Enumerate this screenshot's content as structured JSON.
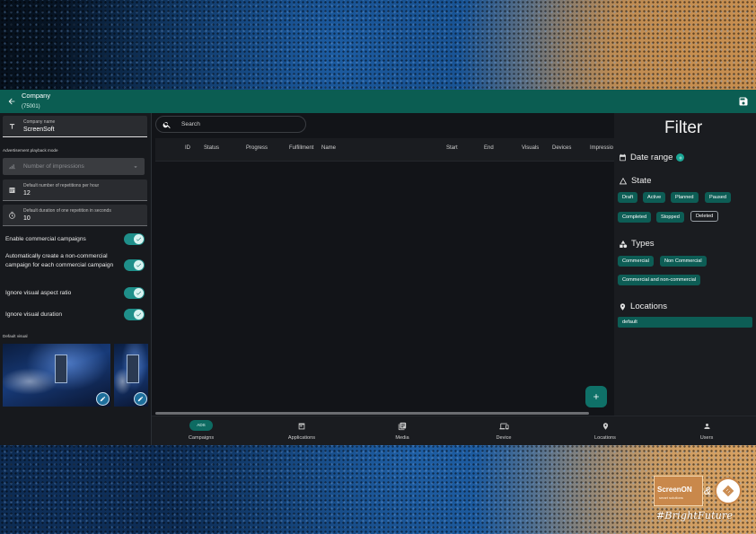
{
  "header": {
    "title": "Company",
    "subtitle": "(75001)"
  },
  "left_panel": {
    "company_name": {
      "label": "Company name",
      "value": "ScreenSoft"
    },
    "playback_mode_label": "Advertisement playback mode",
    "playback_mode_select": {
      "placeholder": "Number of impressions"
    },
    "repetitions_per_hour": {
      "label": "Default number of repetitions per hour",
      "value": "12"
    },
    "repetition_duration": {
      "label": "Default duration of one repetition in seconds",
      "value": "10"
    },
    "toggles": [
      {
        "label": "Enable commercial campaigns",
        "on": true
      },
      {
        "label": "Automatically create a non-commercial campaign for each commercial campaign",
        "on": true
      },
      {
        "label": "Ignore visual aspect ratio",
        "on": true
      },
      {
        "label": "Ignore visual duration",
        "on": true
      }
    ],
    "default_visual_label": "Default visual"
  },
  "main": {
    "search_placeholder": "Search",
    "columns": [
      "ID",
      "Status",
      "Progress",
      "Fulfillment",
      "Name",
      "Start",
      "End",
      "Visuals",
      "Devices",
      "Impressio"
    ]
  },
  "filter": {
    "title": "Filter",
    "date_range": "Date range",
    "state": {
      "title": "State",
      "chips": [
        "Draft",
        "Active",
        "Planned",
        "Paused",
        "Completed",
        "Stopped",
        "Deleted"
      ]
    },
    "types": {
      "title": "Types",
      "chips": [
        "Commercial",
        "Non Commercial",
        "Commercial and non-commercial"
      ]
    },
    "locations": {
      "title": "Locations",
      "items": [
        "default"
      ]
    }
  },
  "bottom_nav": {
    "active_badge": "ADS",
    "items": [
      "Campaigns",
      "Applications",
      "Media",
      "Device",
      "Locations",
      "Users"
    ]
  },
  "brand": {
    "name": "ScreenON",
    "tagline": "smart solutions",
    "ampersand": "&",
    "hashtag": "#BrightFuture"
  },
  "colors": {
    "header_bg": "#0b5d52",
    "accent": "#0d5d55",
    "toggle_on": "#1f8f8a",
    "brand": "#c9884b"
  }
}
